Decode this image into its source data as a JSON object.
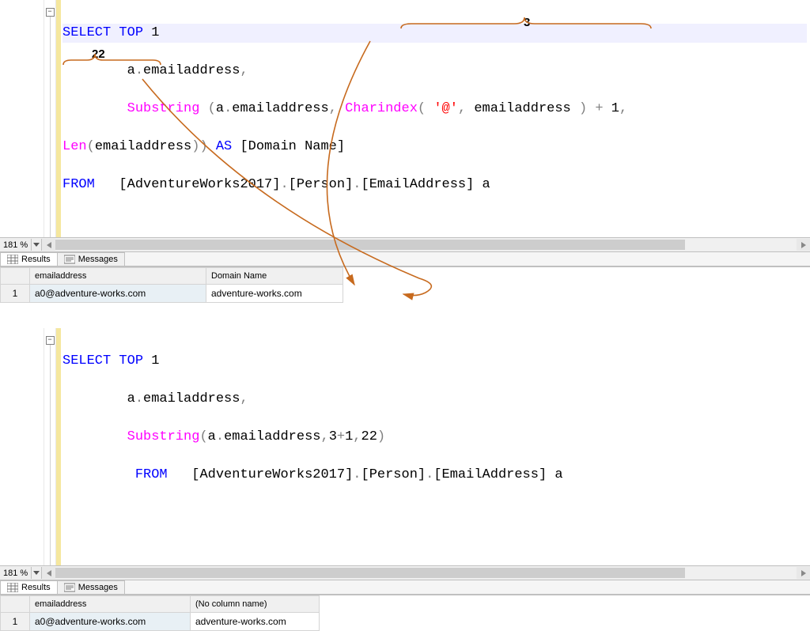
{
  "zoom": "181 %",
  "tabs": {
    "results": "Results",
    "messages": "Messages"
  },
  "annotation": {
    "len_value": "22",
    "charindex_value": "3"
  },
  "editor1": {
    "line1": {
      "select": "SELECT",
      "top": "TOP",
      "one": "1"
    },
    "line2": {
      "alias": "a",
      "dot": ".",
      "col": "emailaddress",
      "comma": ","
    },
    "line3": {
      "fn1": "Substring",
      "open1": " (",
      "a1": "a",
      "dot1": ".",
      "col1": "emailaddress",
      "comma1": ", ",
      "fn2": "Charindex",
      "open2": "(",
      "sp": " ",
      "str": "'@'",
      "comma2": ", ",
      "col2": "emailaddress",
      "sp2": " ",
      "close2": ")",
      "plus": " + ",
      "one": "1",
      "comma3": ","
    },
    "line4": {
      "fn3": "Len",
      "open3": "(",
      "col3": "emailaddress",
      "close3": ")",
      "close_sub": ")",
      " as": " ",
      "kwas": "AS",
      " ": " ",
      "alias_open": "[",
      "alias_name": "Domain Name",
      "alias_close": "]"
    },
    "line5": {
      "from": "FROM",
      "sp": "   ",
      "b1": "[AdventureWorks2017]",
      "dot1": ".",
      "b2": "[Person]",
      "dot2": ".",
      "b3": "[EmailAddress]",
      "sp2": " ",
      "a": "a"
    }
  },
  "results1": {
    "cols": {
      "c1": "emailaddress",
      "c2": "Domain Name"
    },
    "row1": {
      "n": "1",
      "c1": "a0@adventure-works.com",
      "c2": "adventure-works.com"
    }
  },
  "editor2": {
    "line1": {
      "select": "SELECT",
      "top": "TOP",
      "one": "1"
    },
    "line2": {
      "alias": "a",
      "dot": ".",
      "col": "emailaddress",
      "comma": ","
    },
    "line3": {
      "fn": "Substring",
      "open": "(",
      "a": "a",
      "dot": ".",
      "col": "emailaddress",
      "comma": ",",
      "v1": "3",
      "plus": "+",
      "v2": "1",
      "comma2": ",",
      "v3": "22",
      "close": ")"
    },
    "line4": {
      "from": "FROM",
      "sp": "   ",
      "b1": "[AdventureWorks2017]",
      "dot1": ".",
      "b2": "[Person]",
      "dot2": ".",
      "b3": "[EmailAddress]",
      "sp2": " ",
      "a2": "a"
    }
  },
  "results2": {
    "cols": {
      "c1": "emailaddress",
      "c2": "(No column name)"
    },
    "row1": {
      "n": "1",
      "c1": "a0@adventure-works.com",
      "c2": "adventure-works.com"
    }
  }
}
